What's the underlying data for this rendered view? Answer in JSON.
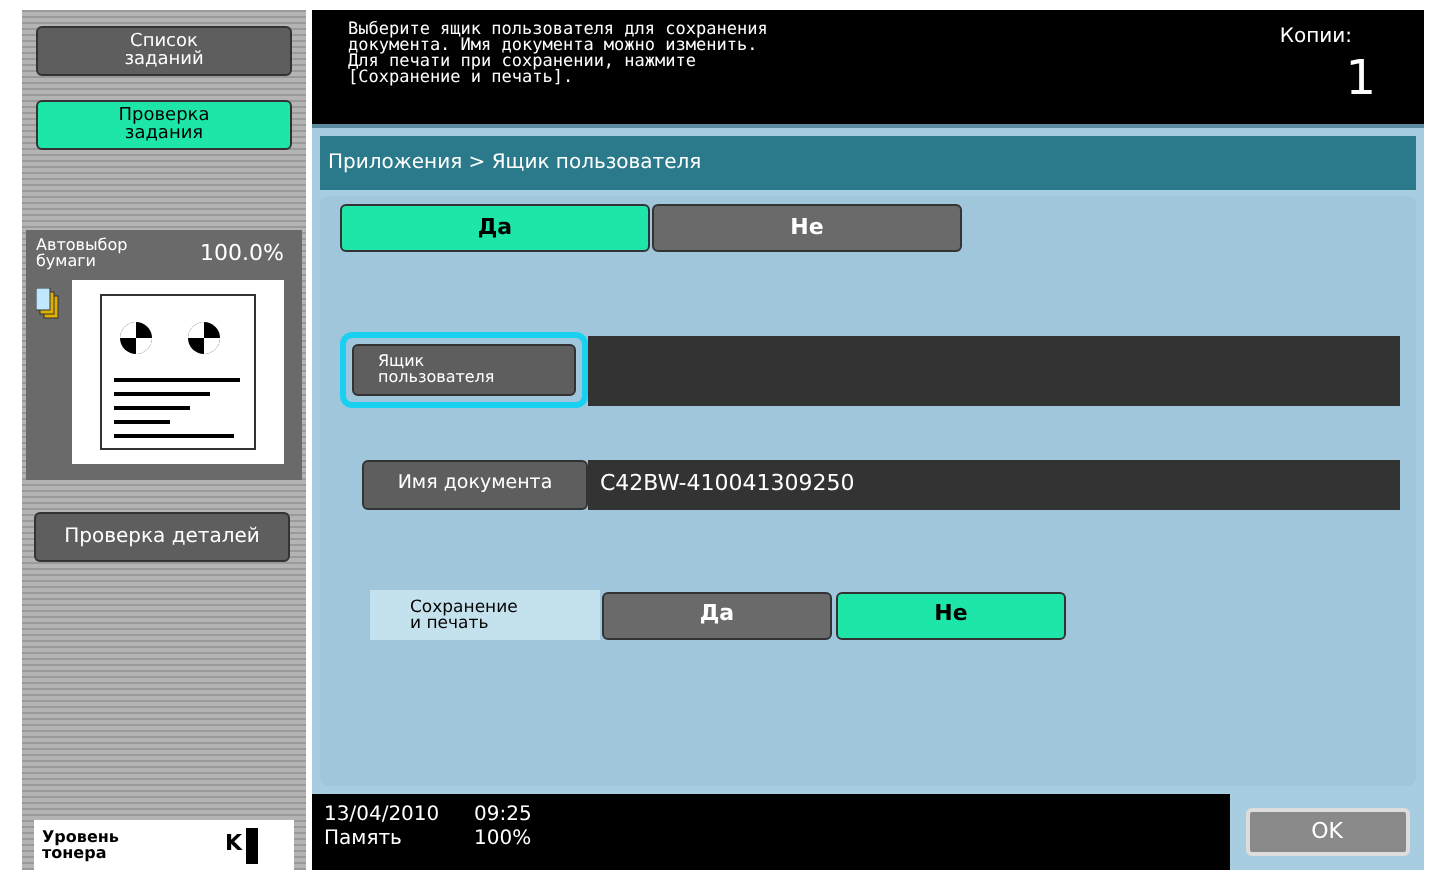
{
  "sidebar": {
    "buttons": [
      {
        "label": "Список\nзаданий",
        "selected": false
      },
      {
        "label": "Проверка\nзадания",
        "selected": true
      }
    ],
    "paper": {
      "label": "Автовыбор\nбумаги",
      "value": "100.0%"
    },
    "details_button": "Проверка деталей",
    "toner": {
      "label": "Уровень\nтонера",
      "code": "K",
      "level": 1
    }
  },
  "message": {
    "lines": [
      "Выберите ящик пользователя для сохранения",
      "документа. Имя документа можно изменить.",
      "Для печати при сохранении, нажмите",
      "[Сохранение и печать]."
    ]
  },
  "copies": {
    "label": "Копии:",
    "value": "1"
  },
  "breadcrumb": "Приложения > Ящик пользователя",
  "top_toggle": [
    {
      "label": "Да",
      "selected": true
    },
    {
      "label": "Не",
      "selected": false
    }
  ],
  "user_box": {
    "label": "Ящик\nпользователя",
    "focused": true
  },
  "document_name": {
    "label": "Имя документа",
    "value": "C42BW-410041309250"
  },
  "save_and_print": {
    "label": "Сохранение\nи печать",
    "options": [
      {
        "label": "Да",
        "selected": false
      },
      {
        "label": "Не",
        "selected": true
      }
    ]
  },
  "status": {
    "date": "13/04/2010",
    "time": "09:25",
    "memory_label": "Память",
    "memory_value": "100%"
  },
  "ok_button": "OK"
}
